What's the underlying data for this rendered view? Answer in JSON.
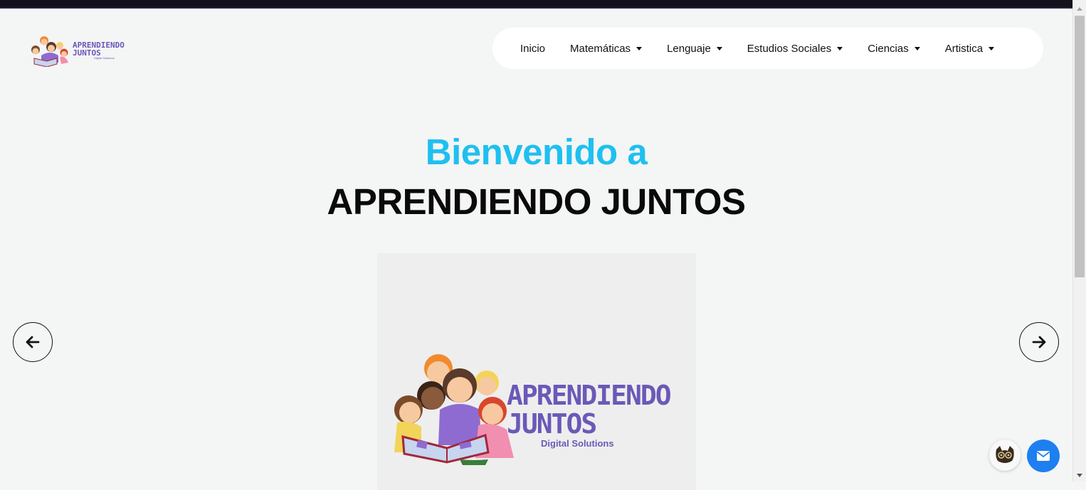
{
  "logo": {
    "line1": "APRENDIENDO",
    "line2": "JUNTOS",
    "line3": "Digital Solutions"
  },
  "nav": {
    "items": [
      {
        "label": "Inicio",
        "dropdown": false
      },
      {
        "label": "Matemáticas",
        "dropdown": true
      },
      {
        "label": "Lenguaje",
        "dropdown": true
      },
      {
        "label": "Estudios Sociales",
        "dropdown": true
      },
      {
        "label": "Ciencias",
        "dropdown": true
      },
      {
        "label": "Artistica",
        "dropdown": true
      }
    ]
  },
  "hero": {
    "title": "Bienvenido a",
    "subtitle": "APRENDIENDO JUNTOS"
  },
  "slide": {
    "line1": "APRENDIENDO",
    "line2": "JUNTOS",
    "line3": "Digital Solutions"
  },
  "controls": {
    "prev_icon": "arrow-left-icon",
    "next_icon": "arrow-right-icon"
  },
  "floating": {
    "cat_icon": "cat-icon",
    "mail_icon": "envelope-icon"
  },
  "colors": {
    "accent": "#1ec0ef",
    "brand": "#6b59b8",
    "mail_button": "#1d7ff0"
  }
}
